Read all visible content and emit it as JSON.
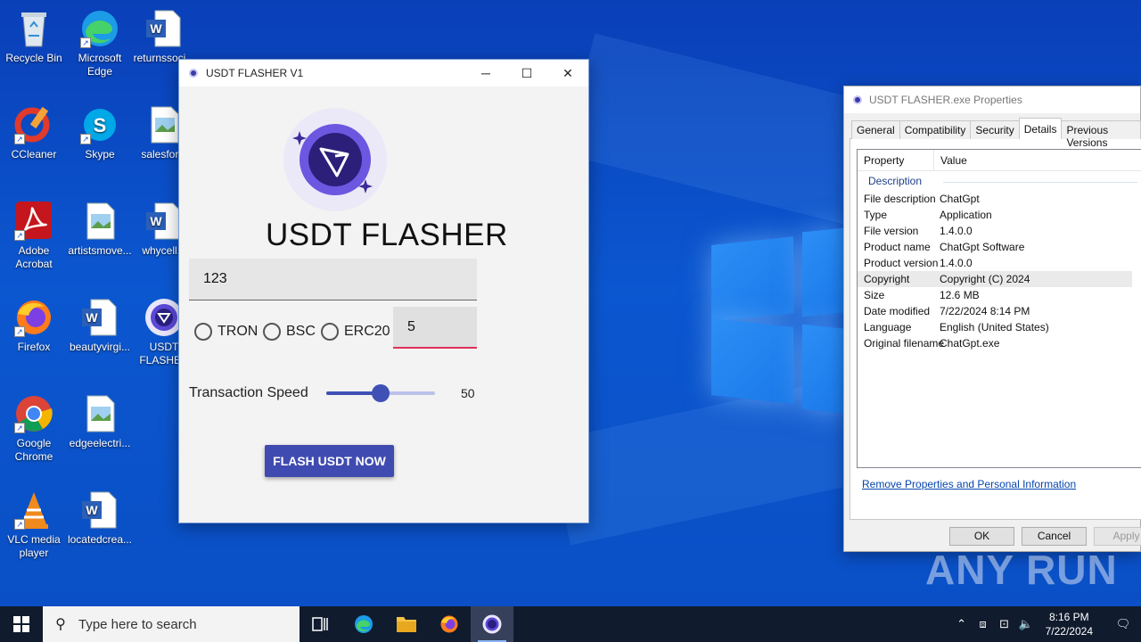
{
  "desktop": {
    "icons": [
      {
        "label": "Recycle Bin"
      },
      {
        "label": "Microsoft Edge"
      },
      {
        "label": "returnssoci..."
      },
      {
        "label": "CCleaner"
      },
      {
        "label": "Skype"
      },
      {
        "label": "salesfor..."
      },
      {
        "label": "Adobe Acrobat"
      },
      {
        "label": "artistsmove..."
      },
      {
        "label": "whycell..."
      },
      {
        "label": "Firefox"
      },
      {
        "label": "beautyvirgi..."
      },
      {
        "label": "USDT FLASHER"
      },
      {
        "label": "Google Chrome"
      },
      {
        "label": "edgeelectri..."
      },
      {
        "label": "VLC media player"
      },
      {
        "label": "locatedcrea..."
      }
    ]
  },
  "app_window": {
    "title": "USDT FLASHER V1",
    "controls": {
      "minimize": "─",
      "maximize": "☐",
      "close": "✕"
    },
    "heading": "USDT FLASHER",
    "amount_value": "123",
    "networks": [
      {
        "label": "TRON",
        "selected": false
      },
      {
        "label": "BSC",
        "selected": false
      },
      {
        "label": "ERC20",
        "selected": false
      }
    ],
    "count_value": "5",
    "speed_label": "Transaction Speed",
    "speed_value": "50",
    "speed_fraction": 0.5,
    "flash_button": "FLASH USDT NOW"
  },
  "properties_dialog": {
    "title": "USDT FLASHER.exe Properties",
    "tabs": [
      {
        "label": "General",
        "active": false
      },
      {
        "label": "Compatibility",
        "active": false
      },
      {
        "label": "Security",
        "active": false
      },
      {
        "label": "Details",
        "active": true
      },
      {
        "label": "Previous Versions",
        "active": false
      }
    ],
    "columns": {
      "property": "Property",
      "value": "Value"
    },
    "group": "Description",
    "rows": [
      {
        "key": "File description",
        "value": "ChatGpt"
      },
      {
        "key": "Type",
        "value": "Application"
      },
      {
        "key": "File version",
        "value": "1.4.0.0"
      },
      {
        "key": "Product name",
        "value": "ChatGpt Software"
      },
      {
        "key": "Product version",
        "value": "1.4.0.0"
      },
      {
        "key": "Copyright",
        "value": "Copyright (C) 2024"
      },
      {
        "key": "Size",
        "value": "12.6 MB"
      },
      {
        "key": "Date modified",
        "value": "7/22/2024 8:14 PM"
      },
      {
        "key": "Language",
        "value": "English (United States)"
      },
      {
        "key": "Original filename",
        "value": "ChatGpt.exe"
      }
    ],
    "remove_link": "Remove Properties and Personal Information",
    "buttons": {
      "ok": "OK",
      "cancel": "Cancel",
      "apply": "Apply"
    }
  },
  "watermark": "ANY RUN",
  "taskbar": {
    "search_placeholder": "Type here to search",
    "time": "8:16 PM",
    "date": "7/22/2024"
  }
}
